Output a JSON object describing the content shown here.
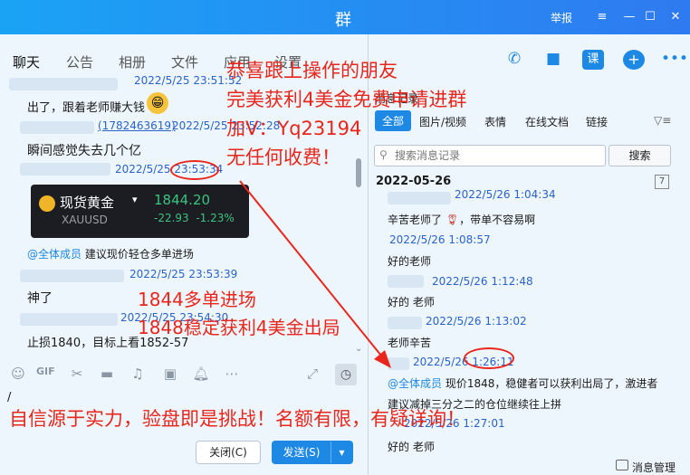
{
  "window": {
    "title": "群",
    "report_label": "举报",
    "controls": [
      "≡",
      "—",
      "☐",
      "✕"
    ]
  },
  "tabs": [
    {
      "label": "聊天",
      "active": true
    },
    {
      "label": "公告"
    },
    {
      "label": "相册"
    },
    {
      "label": "文件"
    },
    {
      "label": "应用"
    },
    {
      "label": "设置"
    }
  ],
  "chat": {
    "messages": [
      {
        "timestamp": "2022/5/25 23:51:52"
      },
      {
        "text": "出了，跟着老师赚大钱"
      },
      {
        "sender": "(1782463619)",
        "timestamp": "2022/5/25 23:52:28"
      },
      {
        "text": "瞬间感觉失去几个亿"
      },
      {
        "timestamp": "2022/5/25 23:53:34"
      },
      {
        "mention": "@全体成员",
        "text": "建议现价轻仓多单进场"
      },
      {
        "timestamp": "2022/5/25 23:53:39"
      },
      {
        "text": "神了"
      },
      {
        "timestamp": "2022/5/25 23:54:30"
      },
      {
        "text": "止损1840，目标上看1852-57"
      }
    ],
    "gold_card": {
      "name": "现货黄金",
      "code": "XAUUSD",
      "price": "1844.20",
      "change": "-22.93",
      "change_pct": "-1.23%"
    }
  },
  "toolbar": {
    "icons": [
      "emoji-icon",
      "gif-icon",
      "scissors-icon",
      "folder-icon",
      "music-icon",
      "image-icon",
      "bell-icon",
      "expand-icon",
      "clock-icon"
    ],
    "gif_label": "GIF",
    "input_value": "/",
    "close_label": "关闭(C)",
    "send_label": "发送(S)"
  },
  "right": {
    "header_label": "消息记录",
    "filters": [
      {
        "label": "全部",
        "active": true
      },
      {
        "label": "图片/视频"
      },
      {
        "label": "表情"
      },
      {
        "label": "在线文档"
      },
      {
        "label": "链接"
      }
    ],
    "search_placeholder": "搜索消息记录",
    "search_button": "搜索",
    "date": "2022-05-26",
    "records": [
      {
        "timestamp": "2022/5/26 1:04:34"
      },
      {
        "text": "辛苦老师了",
        "suffix": "，带单不容易啊"
      },
      {
        "timestamp": "2022/5/26 1:08:57"
      },
      {
        "text": "好的老师"
      },
      {
        "timestamp": "2022/5/26 1:12:48"
      },
      {
        "text": "好的  老师"
      },
      {
        "timestamp": "2022/5/26 1:13:02"
      },
      {
        "text": "老师辛苦"
      },
      {
        "timestamp": "2022/5/26 1:26:11"
      },
      {
        "mention": "@全体成员",
        "text": " 现价1848，稳健者可以获利出局了，激进者"
      },
      {
        "text": "建议减掉三分之二的仓位继续往上拼"
      },
      {
        "timestamp": "2022/5/26 1:27:01"
      },
      {
        "text": "好的  老师"
      }
    ],
    "manage_label": "消息管理"
  },
  "overlay": {
    "promo_lines": [
      "恭喜跟上操作的朋友",
      "完美获利4美金免费申请进群",
      "加V：Yq23194",
      "无任何收费！"
    ],
    "entry_line": "1844多单进场",
    "exit_line": "1848稳定获利4美金出局",
    "bottom_line": "自信源于实力，验盘即是挑战！名额有限，有疑详询！"
  },
  "colors": {
    "title_bar": "#1aa3f5",
    "accent": "#1e88e5",
    "overlay_red": "#e8261c",
    "gold_green": "#3bc37f"
  }
}
